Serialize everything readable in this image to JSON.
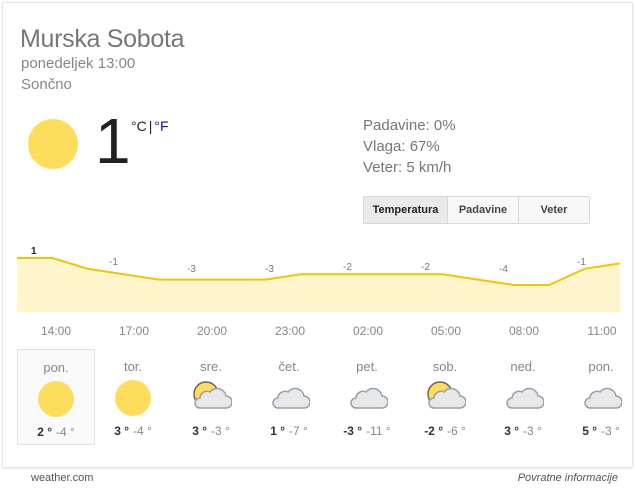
{
  "location": "Murska Sobota",
  "datetime": "ponedeljek 13:00",
  "condition": "Sončno",
  "current": {
    "temperature": "1",
    "unit_c": "°C",
    "unit_sep": "|",
    "unit_f": "°F",
    "icon": "sun-icon"
  },
  "stats": {
    "precip": "Padavine: 0%",
    "humidity": "Vlaga: 67%",
    "wind": "Veter: 5 km/h"
  },
  "tabs": [
    "Temperatura",
    "Padavine",
    "Veter"
  ],
  "active_tab": "Temperatura",
  "chart_data": {
    "type": "area",
    "series": [
      {
        "values": [
          1,
          1,
          -1,
          -2,
          -3,
          -3,
          -3,
          -3,
          -2,
          -2,
          -2,
          -2,
          -2,
          -3,
          -4,
          -4,
          -1,
          0
        ]
      }
    ],
    "point_labels": [
      "1",
      "-1",
      "-3",
      "-3",
      "-2",
      "-2",
      "-4",
      "-1"
    ],
    "x_ticks": [
      "14:00",
      "17:00",
      "20:00",
      "23:00",
      "02:00",
      "05:00",
      "08:00",
      "11:00"
    ],
    "colors": {
      "line": "#f5c400",
      "fill": "#fff5cc"
    }
  },
  "forecast": [
    {
      "day": "pon.",
      "hi": "2 °",
      "lo": "-4 °",
      "icon": "sun-icon"
    },
    {
      "day": "tor.",
      "hi": "3 °",
      "lo": "-4 °",
      "icon": "sun-icon"
    },
    {
      "day": "sre.",
      "hi": "3 °",
      "lo": "-3 °",
      "icon": "partly-cloudy-icon"
    },
    {
      "day": "čet.",
      "hi": "1 °",
      "lo": "-7 °",
      "icon": "cloud-icon"
    },
    {
      "day": "pet.",
      "hi": "-3 °",
      "lo": "-11 °",
      "icon": "cloud-icon"
    },
    {
      "day": "sob.",
      "hi": "-2 °",
      "lo": "-6 °",
      "icon": "partly-cloudy-icon"
    },
    {
      "day": "ned.",
      "hi": "3 °",
      "lo": "-3 °",
      "icon": "cloud-icon"
    },
    {
      "day": "pon.",
      "hi": "5 °",
      "lo": "-3 °",
      "icon": "cloud-icon"
    }
  ],
  "footer": {
    "source": "weather.com",
    "feedback": "Povratne informacije"
  },
  "colors": {
    "accent": "#1a0dab",
    "sun": "#ffdd5c",
    "cloud": "#cfd3d6"
  }
}
